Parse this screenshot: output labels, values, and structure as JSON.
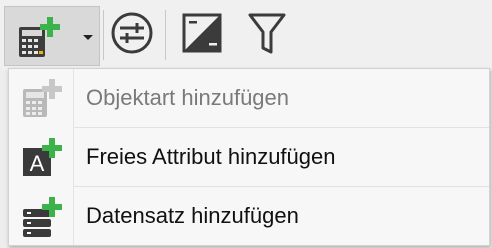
{
  "toolbar": {
    "buttons": [
      {
        "icon": "calculator-add-icon",
        "has_dropdown": true
      },
      {
        "icon": "adjust-sliders-icon"
      },
      {
        "icon": "contrast-square-icon"
      },
      {
        "icon": "filter-funnel-icon"
      }
    ]
  },
  "menu": {
    "items": [
      {
        "label": "Objektart hinzufügen",
        "icon": "calculator-add-icon",
        "enabled": false
      },
      {
        "label": "Freies Attribut hinzufügen",
        "icon": "attribute-a-add-icon",
        "enabled": true
      },
      {
        "label": "Datensatz hinzufügen",
        "icon": "dataset-add-icon",
        "enabled": true
      }
    ]
  },
  "colors": {
    "plus_green": "#3cb34a",
    "icon_dark": "#3b3b3b",
    "disabled_text": "#7a7a7a"
  }
}
